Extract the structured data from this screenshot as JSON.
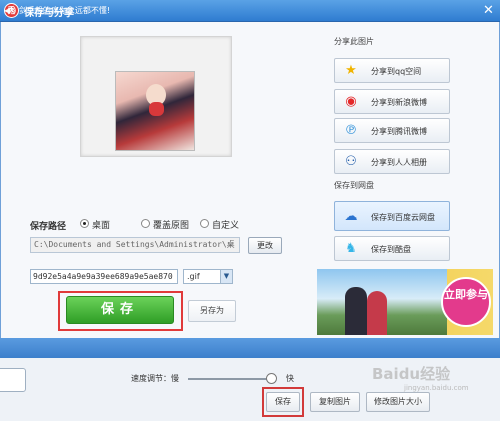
{
  "window": {
    "title": "保存与分享",
    "app_icon_glyph": "秀",
    "close_glyph": "✕"
  },
  "save_panel": {
    "path_label": "保存路径",
    "path_options": [
      {
        "label": "桌面",
        "selected": true
      },
      {
        "label": "覆盖原图",
        "selected": false
      },
      {
        "label": "自定义",
        "selected": false
      }
    ],
    "path_value": "C:\\Documents and Settings\\Administrator\\桌",
    "change_label": "更改",
    "file_name": "9d92e5a4a9e9a39ee689a9e5ae870",
    "file_ext": ".gif",
    "save_label": "保存",
    "save_as_label": "另存为"
  },
  "share_panel": {
    "share_title": "分享此图片",
    "share_items": [
      {
        "label": "分享到qq空间",
        "icon": "star-icon"
      },
      {
        "label": "分享到新浪微博",
        "icon": "weibo-icon"
      },
      {
        "label": "分享到腾讯微博",
        "icon": "tencent-weibo-icon"
      },
      {
        "label": "分享到人人相册",
        "icon": "renren-icon"
      }
    ],
    "cloud_title": "保存到网盘",
    "cloud_items": [
      {
        "label": "保存到百度云网盘",
        "icon": "baidu-cloud-icon"
      },
      {
        "label": "保存到酷盘",
        "icon": "kupan-icon"
      }
    ],
    "banner_text": "立即参与"
  },
  "status_bar": {
    "text": "◀)) 剑手般的痛你永远都不懂!"
  },
  "bottom_bar": {
    "speed_label": "速度调节：慢",
    "fast_label": "快",
    "speed_value": 0.95,
    "buttons": [
      "保存",
      "复制图片",
      "修改图片大小"
    ]
  },
  "watermark": {
    "text": "Baidu经验",
    "sub": "jingyan.baidu.com"
  },
  "colors": {
    "accent": "#3b82d4",
    "save_green": "#3aa82f",
    "highlight_red": "#e03a3a"
  }
}
